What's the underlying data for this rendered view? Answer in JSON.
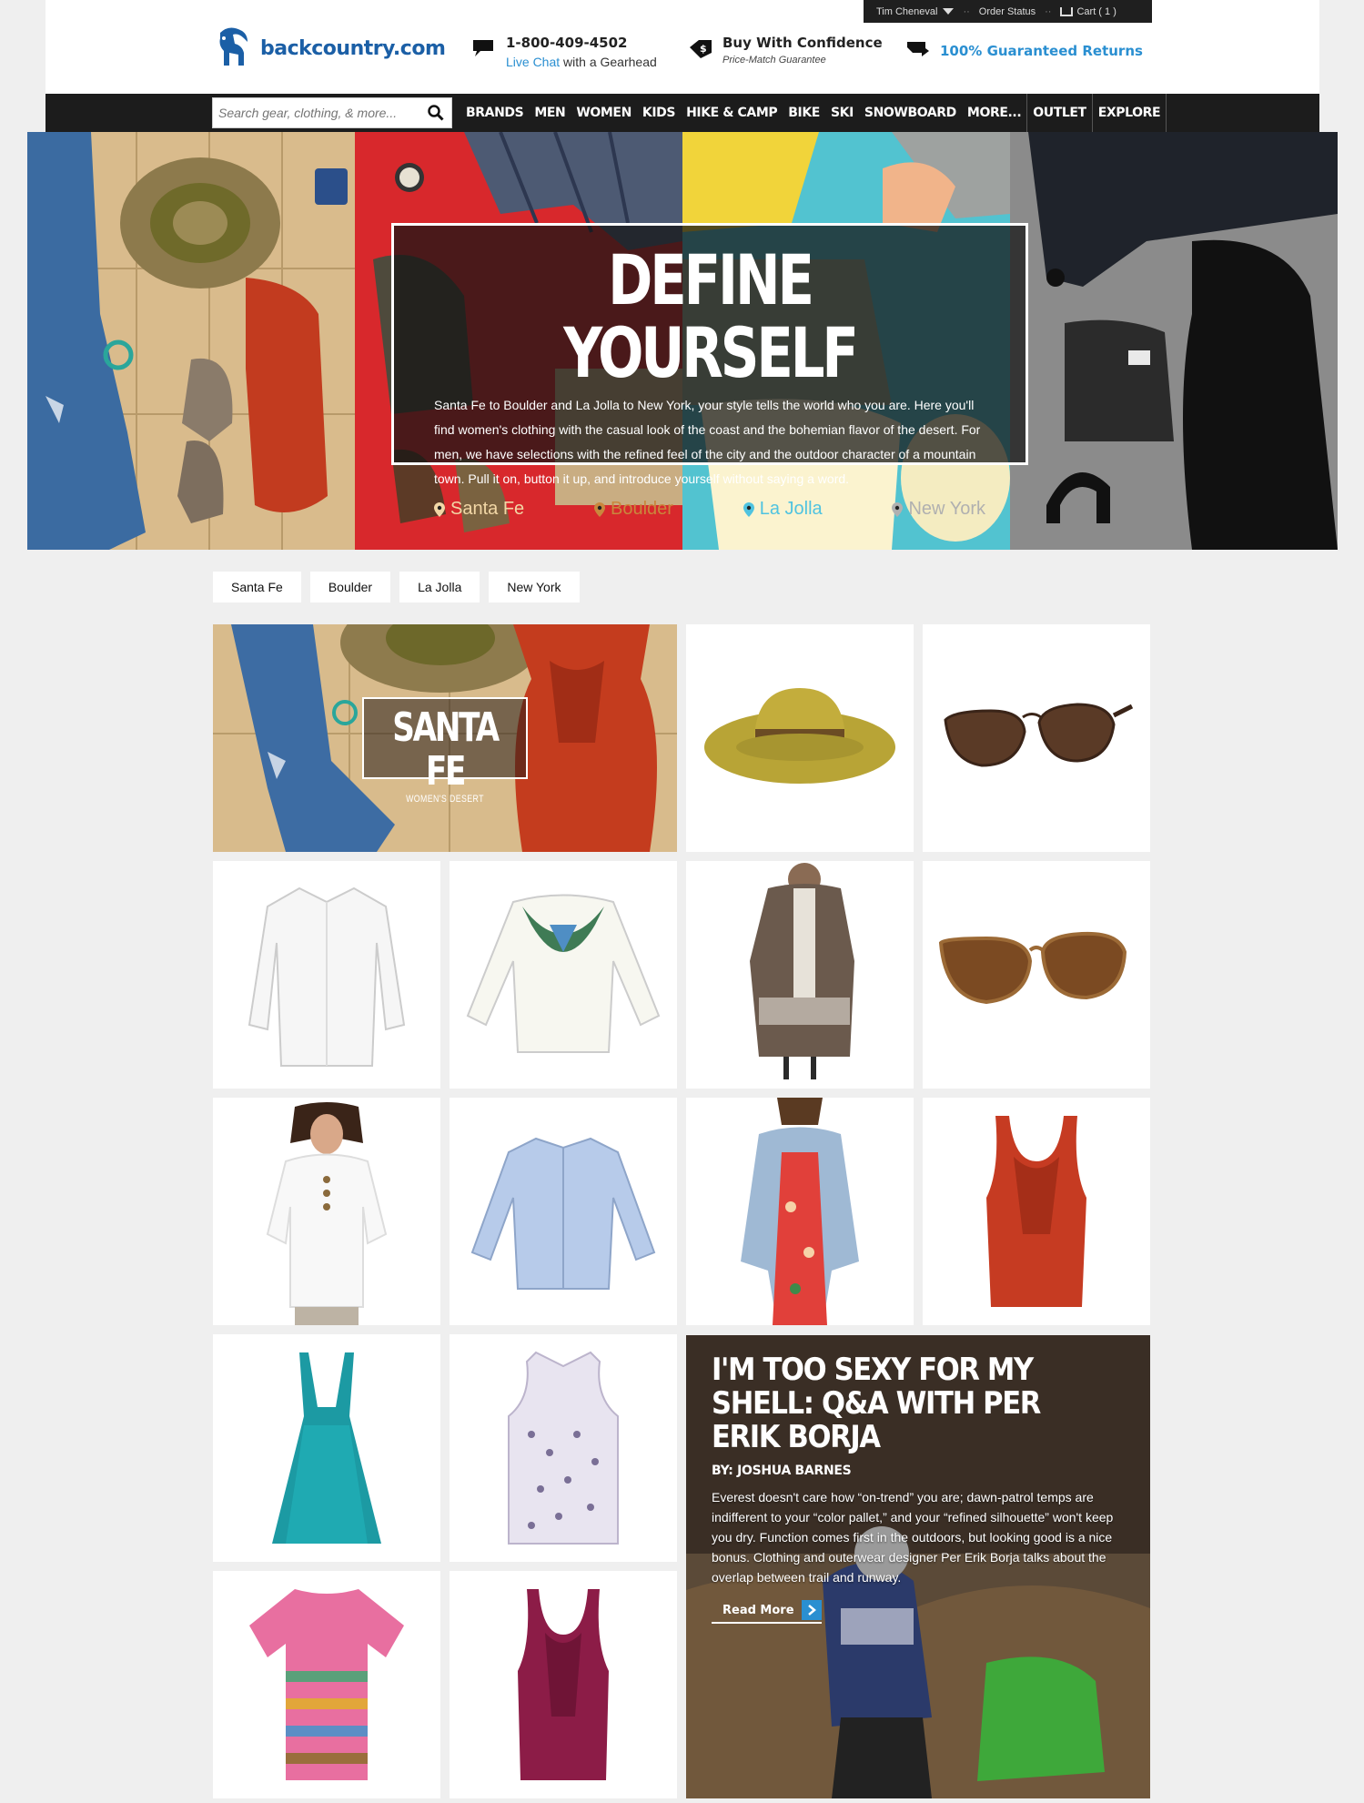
{
  "util": {
    "user": "Tim Cheneval",
    "order_status": "Order Status",
    "cart": "Cart ( 1 )"
  },
  "logo": {
    "text": "backcountry.com"
  },
  "promos": {
    "phone": "1-800-409-4502",
    "live_chat": "Live Chat",
    "gearhead": " with a Gearhead",
    "confidence": "Buy With Confidence",
    "price_match": "Price-Match Guarantee",
    "returns": "100% Guaranteed Returns"
  },
  "search": {
    "placeholder": "Search gear, clothing, & more..."
  },
  "nav": [
    "BRANDS",
    "MEN",
    "WOMEN",
    "KIDS",
    "HIKE & CAMP",
    "BIKE",
    "SKI",
    "SNOWBOARD",
    "MORE...",
    "OUTLET",
    "EXPLORE"
  ],
  "hero": {
    "title": "DEFINE YOURSELF",
    "body": "Santa Fe to Boulder and La Jolla to New York, your style tells the world who you are. Here you'll find women's clothing with the casual look of the coast and the bohemian flavor of the desert. For men, we have selections with the refined feel of the city and the outdoor character of a mountain town. Pull it on, button it up, and introduce yourself without saying a word.",
    "cities": [
      "Santa Fe",
      "Boulder",
      "La Jolla",
      "New York"
    ],
    "city_colors": [
      "#f2d7a6",
      "#c9873d",
      "#4fc3e0",
      "#b0b0b0"
    ]
  },
  "filters": [
    "Santa Fe",
    "Boulder",
    "La Jolla",
    "New York"
  ],
  "santafe_tile": {
    "title": "SANTA FE",
    "subtitle": "WOMEN'S DESERT"
  },
  "article": {
    "title": "I'm Too Sexy For My Shell: Q&A With Per Erik Borja",
    "byline": "BY: JOSHUA BARNES",
    "body": "Everest doesn't care how “on-trend” you are; dawn-patrol temps are indifferent to your “color pallet,” and your “refined silhouette” won't keep you dry. Function comes first in the outdoors, but looking good is a nice bonus. Clothing and outerwear designer Per Erik Borja talks about the overlap between trail and runway.",
    "read_more": "Read More"
  },
  "colors": {
    "brand_blue": "#1b5fa6",
    "accent_blue": "#2a8fd1",
    "nav_bg": "#1c1c1c"
  }
}
